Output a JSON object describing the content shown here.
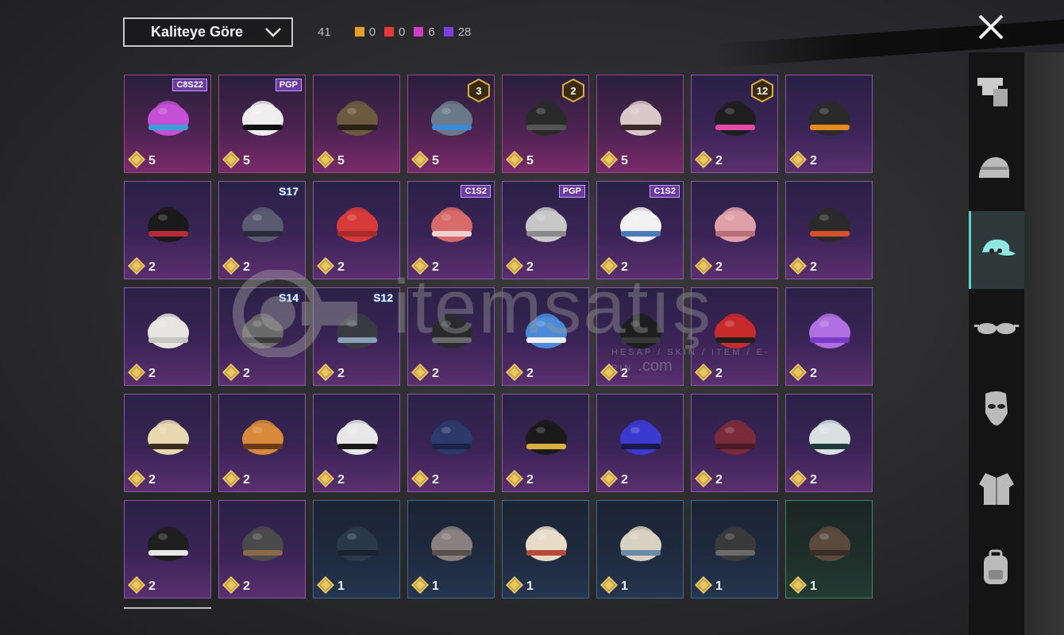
{
  "sort": {
    "label": "Kaliteye Göre"
  },
  "counts": {
    "total": "41",
    "items": [
      {
        "color": "#e8a020",
        "value": "0"
      },
      {
        "color": "#e83838",
        "value": "0"
      },
      {
        "color": "#d43ac8",
        "value": "6"
      },
      {
        "color": "#7b3fe8",
        "value": "28"
      }
    ]
  },
  "watermark": {
    "text": "itemsatış",
    "sub": "HESAP / SKIN / ITEM / E-PIN",
    "suffix": ".com"
  },
  "tiles": [
    {
      "rarity": "pink",
      "count": "5",
      "icon": "wig-icon",
      "badge": "C8S22"
    },
    {
      "rarity": "pink",
      "count": "5",
      "icon": "panda-mask-icon",
      "badge": "PGP"
    },
    {
      "rarity": "pink",
      "count": "5",
      "icon": "feather-icon",
      "badge": ""
    },
    {
      "rarity": "pink",
      "count": "5",
      "icon": "ufo-hat-icon",
      "badge": "3"
    },
    {
      "rarity": "pink",
      "count": "5",
      "icon": "predator-helmet-icon",
      "badge": "2"
    },
    {
      "rarity": "pink",
      "count": "5",
      "icon": "skull-mask-icon",
      "badge": ""
    },
    {
      "rarity": "purple",
      "count": "2",
      "icon": "bunny-helmet-icon",
      "badge": "12"
    },
    {
      "rarity": "purple",
      "count": "2",
      "icon": "black-cap-icon",
      "badge": ""
    },
    {
      "rarity": "purple",
      "count": "2",
      "icon": "bucket-hat-hair-icon",
      "badge": ""
    },
    {
      "rarity": "purple",
      "count": "2",
      "icon": "horned-helmet-icon",
      "badge": "S17"
    },
    {
      "rarity": "purple",
      "count": "2",
      "icon": "fez-icon",
      "badge": ""
    },
    {
      "rarity": "purple",
      "count": "2",
      "icon": "bandana-icon",
      "badge": "C1S2"
    },
    {
      "rarity": "purple",
      "count": "2",
      "icon": "grey-wig-icon",
      "badge": "PGP"
    },
    {
      "rarity": "purple",
      "count": "2",
      "icon": "chef-hat-icon",
      "badge": "C1S2"
    },
    {
      "rarity": "purple",
      "count": "2",
      "icon": "pink-hair-icon",
      "badge": ""
    },
    {
      "rarity": "purple",
      "count": "2",
      "icon": "ponytail-helmet-icon",
      "badge": ""
    },
    {
      "rarity": "purple",
      "count": "2",
      "icon": "beanie-icon",
      "badge": ""
    },
    {
      "rarity": "purple",
      "count": "2",
      "icon": "spartan-helmet-icon",
      "badge": "S14"
    },
    {
      "rarity": "purple",
      "count": "2",
      "icon": "visor-helmet-icon",
      "badge": "S12"
    },
    {
      "rarity": "purple",
      "count": "2",
      "icon": "ninja-helmet-icon",
      "badge": ""
    },
    {
      "rarity": "purple",
      "count": "2",
      "icon": "shark-hat-icon",
      "badge": ""
    },
    {
      "rarity": "purple",
      "count": "2",
      "icon": "black-fedora-icon",
      "badge": ""
    },
    {
      "rarity": "purple",
      "count": "2",
      "icon": "red-fedora-icon",
      "badge": ""
    },
    {
      "rarity": "purple",
      "count": "2",
      "icon": "flower-crown-icon",
      "badge": ""
    },
    {
      "rarity": "purple",
      "count": "2",
      "icon": "cake-hat-icon",
      "badge": ""
    },
    {
      "rarity": "purple",
      "count": "2",
      "icon": "burger-hat-icon",
      "badge": ""
    },
    {
      "rarity": "purple",
      "count": "2",
      "icon": "head-mirror-icon",
      "badge": ""
    },
    {
      "rarity": "purple",
      "count": "2",
      "icon": "sailor-cap-icon",
      "badge": ""
    },
    {
      "rarity": "purple",
      "count": "2",
      "icon": "gold-cap-icon",
      "badge": ""
    },
    {
      "rarity": "purple",
      "count": "2",
      "icon": "blue-cap-icon",
      "badge": ""
    },
    {
      "rarity": "purple",
      "count": "2",
      "icon": "maroon-fedora-icon",
      "badge": ""
    },
    {
      "rarity": "purple",
      "count": "2",
      "icon": "doo-rag-icon",
      "badge": ""
    },
    {
      "rarity": "purple",
      "count": "2",
      "icon": "black-bucket-hat-icon",
      "badge": ""
    },
    {
      "rarity": "purple",
      "count": "2",
      "icon": "aviator-cap-icon",
      "badge": ""
    },
    {
      "rarity": "blue",
      "count": "1",
      "icon": "navy-beret-icon",
      "badge": ""
    },
    {
      "rarity": "blue",
      "count": "1",
      "icon": "grey-beret-icon",
      "badge": ""
    },
    {
      "rarity": "blue",
      "count": "1",
      "icon": "trucker-cap-icon",
      "badge": ""
    },
    {
      "rarity": "blue",
      "count": "1",
      "icon": "denim-cap-icon",
      "badge": ""
    },
    {
      "rarity": "blue",
      "count": "1",
      "icon": "tactical-cap-icon",
      "badge": ""
    },
    {
      "rarity": "green",
      "count": "1",
      "icon": "patrol-cap-icon",
      "badge": ""
    }
  ],
  "sidebar": [
    {
      "icon": "outfit-icon",
      "active": false
    },
    {
      "icon": "helmet-icon",
      "active": false
    },
    {
      "icon": "hat-icon",
      "active": true
    },
    {
      "icon": "glasses-icon",
      "active": false
    },
    {
      "icon": "mask-icon",
      "active": false
    },
    {
      "icon": "jacket-icon",
      "active": false
    },
    {
      "icon": "backpack-icon",
      "active": false
    }
  ]
}
